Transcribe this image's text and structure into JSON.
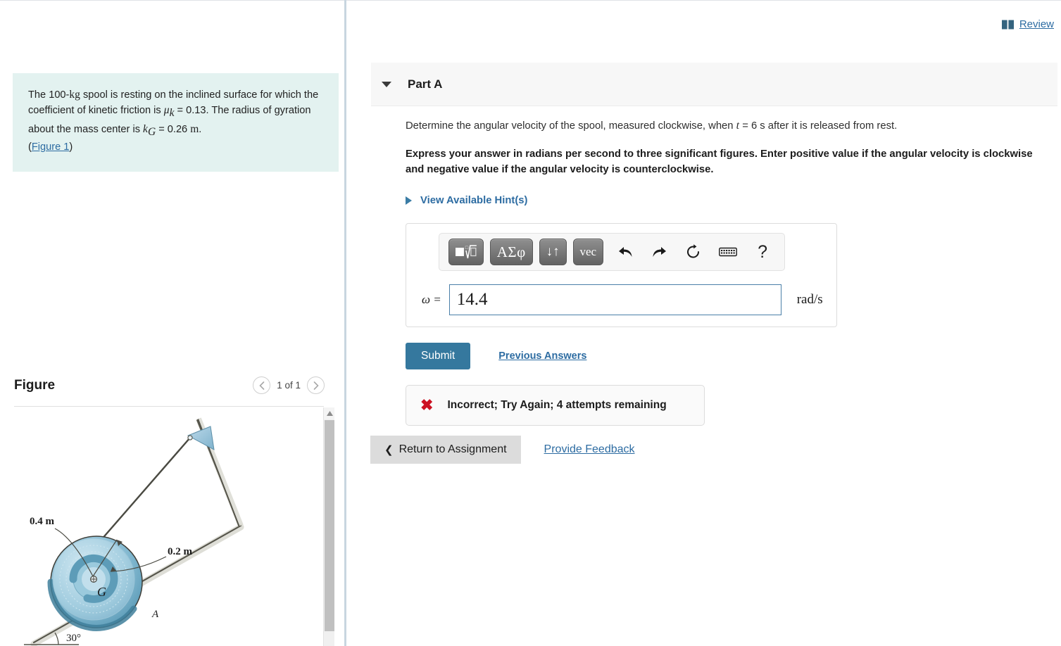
{
  "header": {
    "review_label": "Review",
    "review_icon": "book-icon"
  },
  "left": {
    "problem": {
      "t1": "The 100-",
      "kg": "kg",
      "t2": " spool is resting on the inclined surface for which the coefficient of kinetic friction is ",
      "mu": "μ",
      "mu_sub": "k",
      "t3": " = 0.13. The radius of gyration about the mass center is ",
      "kg_var": "k",
      "kg_sub": "G",
      "t4": " = 0.26 ",
      "m_unit": "m",
      "t5": ".",
      "figure_link": "Figure 1",
      "paren_open": "(",
      "paren_close": ")"
    },
    "figure_section": {
      "title": "Figure",
      "prev_icon": "chevron-left-icon",
      "next_icon": "chevron-right-icon",
      "counter": "1 of 1"
    },
    "figure_diagram": {
      "label_outer_radius": "0.4 m",
      "label_inner_radius": "0.2 m",
      "label_center": "G",
      "label_contact": "A",
      "label_angle": "30°",
      "spool_outer_color": "#7fb4cc",
      "spool_mid_color": "#a9cfe0",
      "spool_inner_color": "#5c9cba",
      "surface_color": "#4a4a42"
    }
  },
  "right": {
    "part": {
      "collapse_icon": "caret-down-icon",
      "title": "Part A"
    },
    "question": {
      "prompt_a": "Determine the angular velocity of the spool, measured clockwise, when ",
      "prompt_var": "t",
      "prompt_b": " = 6 s after it is released from rest.",
      "instruction": "Express your answer in radians per second to three significant figures. Enter positive value if the angular velocity is clockwise and negative value if the angular velocity is counterclockwise.",
      "hints_label": "View Available Hint(s)",
      "hints_icon": "caret-right-icon"
    },
    "mathbar": {
      "buttons": [
        {
          "name": "template-radical-button",
          "label": "■√□",
          "icon": "radical-template-icon"
        },
        {
          "name": "greek-symbols-button",
          "label": "ΑΣφ",
          "icon": "greek-icon"
        },
        {
          "name": "sort-arrows-button",
          "label": "↓↑",
          "icon": "up-down-arrows-icon"
        },
        {
          "name": "vector-button",
          "label": "vec",
          "icon": "vector-icon"
        }
      ],
      "icons": [
        {
          "name": "undo-icon",
          "glyph": "↶"
        },
        {
          "name": "redo-icon",
          "glyph": "↷"
        },
        {
          "name": "reset-icon",
          "glyph": "↺"
        },
        {
          "name": "keyboard-icon",
          "glyph": "⌨"
        },
        {
          "name": "help-icon",
          "glyph": "?"
        }
      ]
    },
    "answer": {
      "variable_label": "ω =",
      "value": "14.4",
      "placeholder": "",
      "unit": "rad/s"
    },
    "actions": {
      "submit_label": "Submit",
      "previous_answers_label": "Previous Answers"
    },
    "feedback": {
      "icon": "x-mark-icon",
      "glyph": "✖",
      "text": "Incorrect; Try Again; 4 attempts remaining"
    },
    "footer": {
      "return_label": "Return to Assignment",
      "return_icon": "chevron-left-icon",
      "feedback_link": "Provide Feedback"
    }
  },
  "colors": {
    "accent": "#2d6ca2",
    "submit": "#35789e",
    "problem_bg": "#e3f2f0",
    "error": "#cc1122"
  }
}
